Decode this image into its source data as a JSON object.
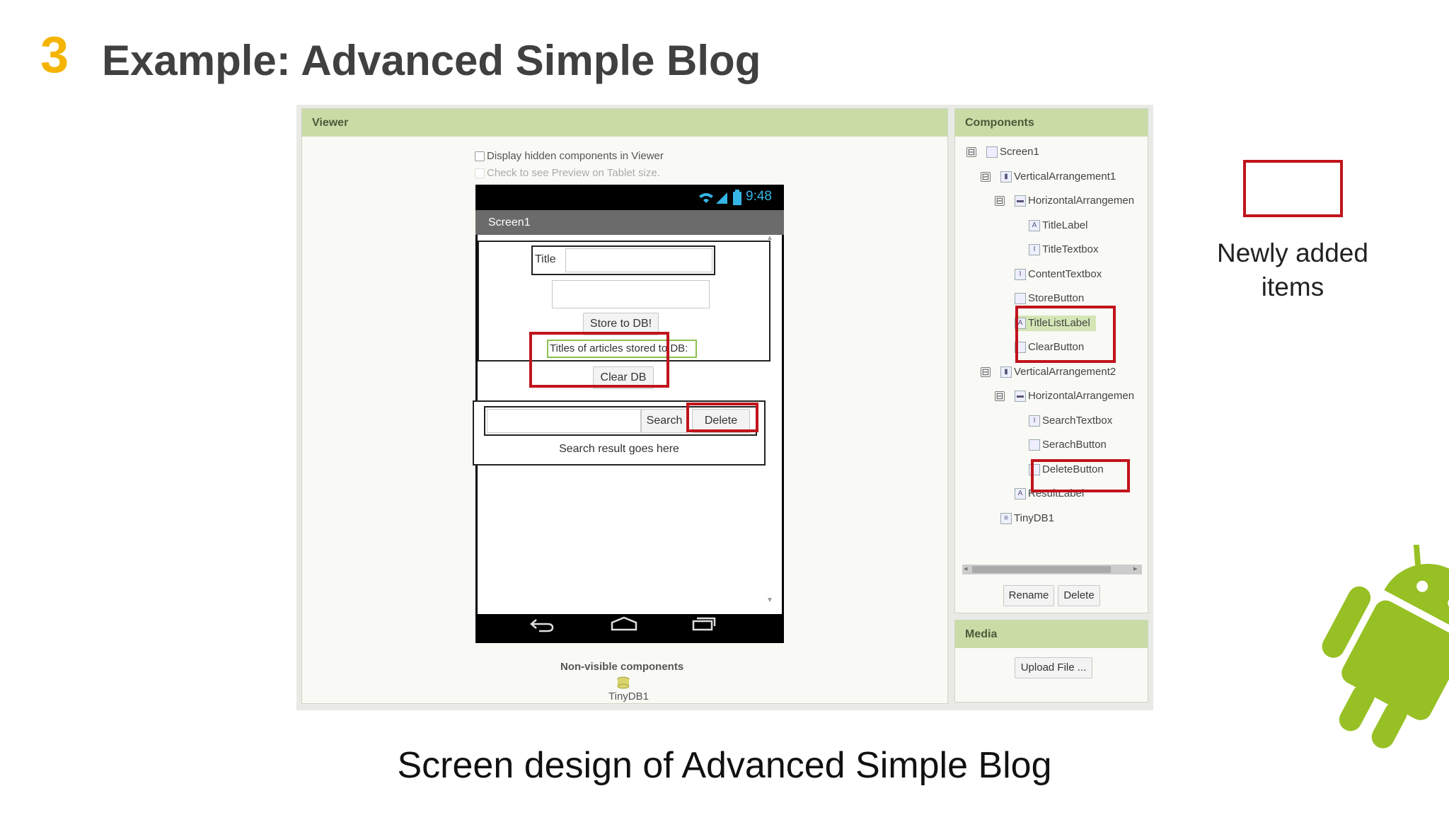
{
  "slide": {
    "number": "3",
    "title": "Example: Advanced Simple Blog",
    "caption": "Screen design of Advanced Simple Blog",
    "legend_text": "Newly added items",
    "accent_color": "#f5b400",
    "highlight_color": "#c0141c"
  },
  "viewer": {
    "header": "Viewer",
    "display_hidden_label": "Display hidden components in Viewer",
    "tablet_preview_label": "Check to see Preview on Tablet size.",
    "phone": {
      "time": "9:48",
      "screen_title": "Screen1",
      "title_label": "Title",
      "store_button": "Store to DB!",
      "title_list_label": "Titles of articles stored to DB:",
      "clear_button": "Clear DB",
      "search_button": "Search",
      "delete_button": "Delete",
      "result_label": "Search result goes here"
    },
    "nonvisible_header": "Non-visible components",
    "nonvisible_item": "TinyDB1"
  },
  "components": {
    "header": "Components",
    "tree": [
      {
        "label": "Screen1",
        "icon": "screen-icon",
        "toggle": "⊟"
      },
      {
        "label": "VerticalArrangement1",
        "icon": "vertical-arrangement-icon",
        "toggle": "⊟"
      },
      {
        "label": "HorizontalArrangemen",
        "icon": "horizontal-arrangement-icon",
        "toggle": "⊟"
      },
      {
        "label": "TitleLabel",
        "icon": "label-icon"
      },
      {
        "label": "TitleTextbox",
        "icon": "textbox-icon"
      },
      {
        "label": "ContentTextbox",
        "icon": "textbox-icon"
      },
      {
        "label": "StoreButton",
        "icon": "button-icon"
      },
      {
        "label": "TitleListLabel",
        "icon": "label-icon"
      },
      {
        "label": "ClearButton",
        "icon": "button-icon"
      },
      {
        "label": "VerticalArrangement2",
        "icon": "vertical-arrangement-icon",
        "toggle": "⊟"
      },
      {
        "label": "HorizontalArrangemen",
        "icon": "horizontal-arrangement-icon",
        "toggle": "⊟"
      },
      {
        "label": "SearchTextbox",
        "icon": "textbox-icon"
      },
      {
        "label": "SerachButton",
        "icon": "button-icon"
      },
      {
        "label": "DeleteButton",
        "icon": "button-icon"
      },
      {
        "label": "ResultLabel",
        "icon": "label-icon"
      },
      {
        "label": "TinyDB1",
        "icon": "database-icon"
      }
    ],
    "rename_button": "Rename",
    "delete_button": "Delete"
  },
  "media": {
    "header": "Media",
    "upload_button": "Upload File ..."
  }
}
